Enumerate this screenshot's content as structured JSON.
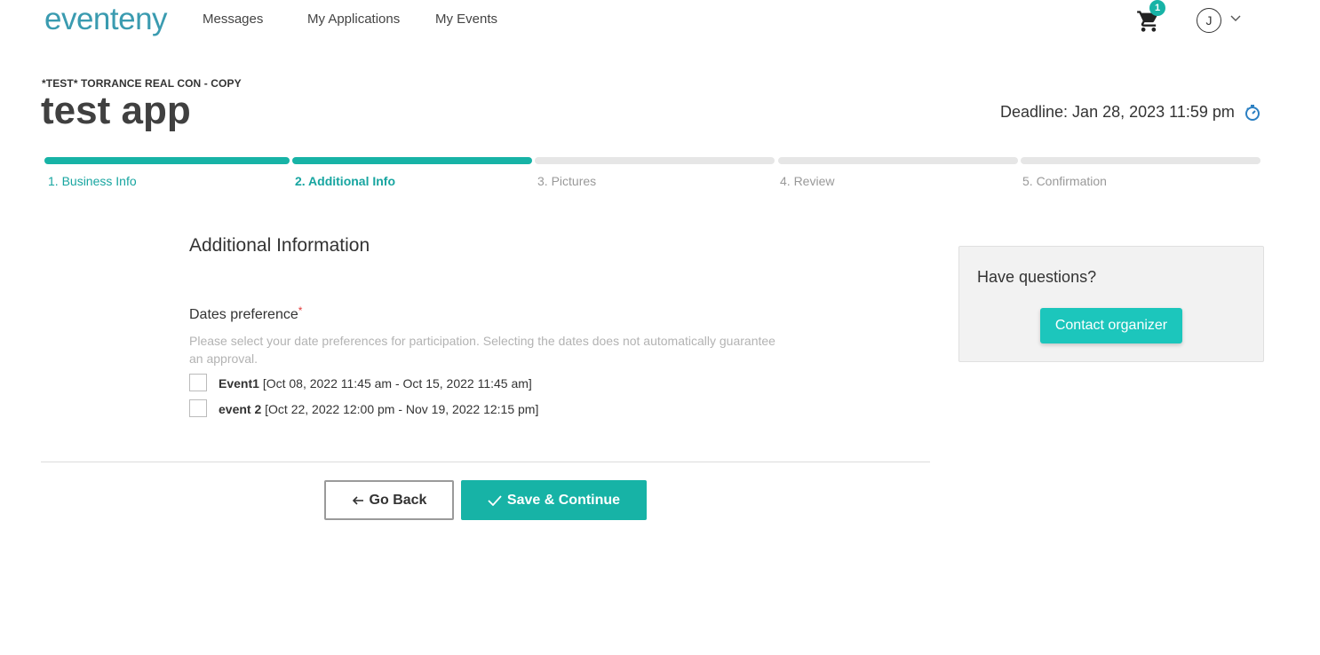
{
  "nav": {
    "logo": "eventeny",
    "links": [
      "Messages",
      "My Applications",
      "My Events"
    ],
    "cart_count": "1",
    "avatar_initial": "J"
  },
  "header": {
    "event_name": "*TEST* TORRANCE REAL CON - COPY",
    "title": "test app",
    "deadline": "Deadline: Jan 28, 2023 11:59 pm"
  },
  "steps": [
    {
      "label": "1. Business Info",
      "state": "done"
    },
    {
      "label": "2. Additional Info",
      "state": "current"
    },
    {
      "label": "3. Pictures",
      "state": "todo"
    },
    {
      "label": "4. Review",
      "state": "todo"
    },
    {
      "label": "5. Confirmation",
      "state": "todo"
    }
  ],
  "form": {
    "section_title": "Additional Information",
    "field_label": "Dates preference",
    "required_mark": "*",
    "help_text": "Please select your date preferences for participation. Selecting the dates does not automatically guarantee an approval.",
    "options": [
      {
        "name": "Event1",
        "dates": "[Oct 08, 2022 11:45 am - Oct 15, 2022 11:45 am]",
        "checked": false
      },
      {
        "name": "event 2",
        "dates": "[Oct 22, 2022 12:00 pm - Nov 19, 2022 12:15 pm]",
        "checked": false
      }
    ],
    "back_label": "Go Back",
    "save_label": "Save & Continue"
  },
  "sidebar": {
    "title": "Have questions?",
    "contact_label": "Contact organizer"
  },
  "colors": {
    "accent": "#17b3a6",
    "logo": "#3a9bb0",
    "required": "#e23b3b"
  }
}
